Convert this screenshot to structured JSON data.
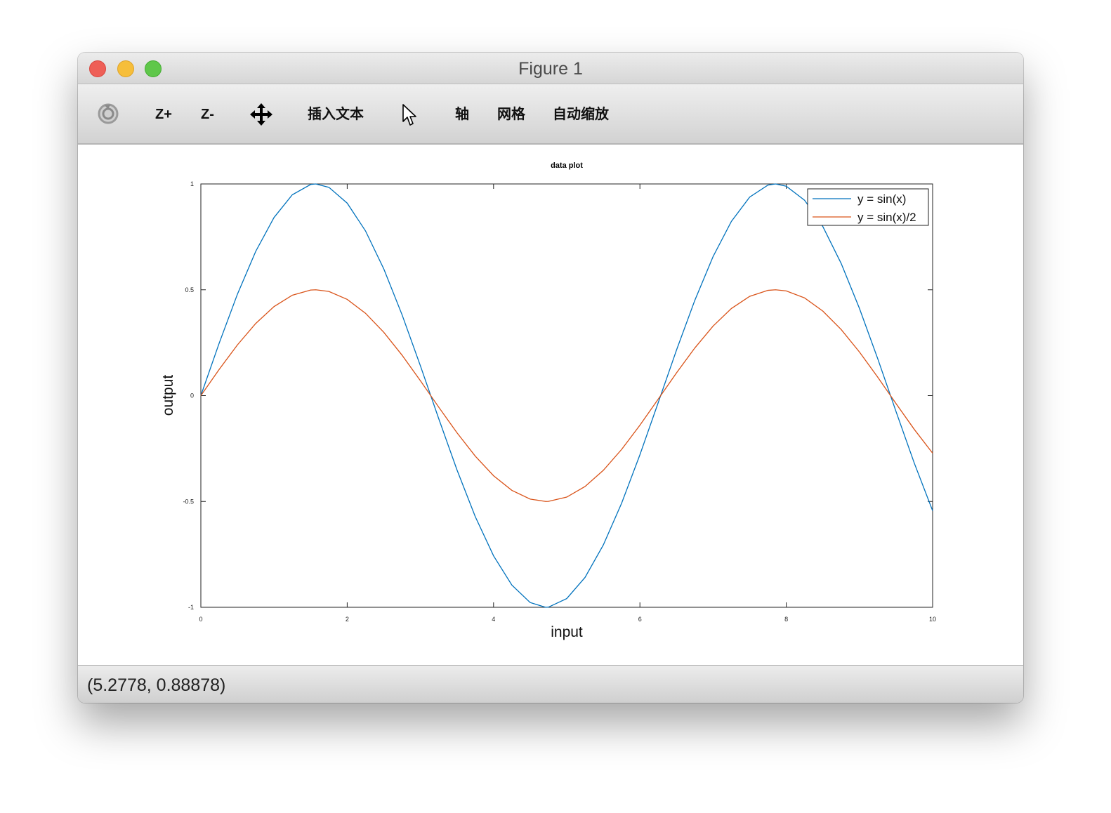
{
  "window": {
    "title": "Figure 1"
  },
  "toolbar": {
    "rotate_icon": "rotate-icon",
    "zoom_in_label": "Z+",
    "zoom_out_label": "Z-",
    "pan_icon": "move-arrows-icon",
    "insert_text_label": "插入文本",
    "select_icon": "cursor-arrow-icon",
    "axis_label": "轴",
    "grid_label": "网格",
    "autoscale_label": "自动缩放"
  },
  "status": {
    "coordinates": "(5.2778, 0.88878)"
  },
  "colors": {
    "series1": "#0072bd",
    "series2": "#d95319"
  },
  "chart_data": {
    "type": "line",
    "title": "data plot",
    "xlabel": "input",
    "ylabel": "output",
    "xlim": [
      0,
      10
    ],
    "ylim": [
      -1,
      1
    ],
    "xticks": [
      "0",
      "2",
      "4",
      "6",
      "8",
      "10"
    ],
    "yticks": [
      "-1",
      "-0.5",
      "0",
      "0.5",
      "1"
    ],
    "grid": false,
    "legend_position": "top-right",
    "series": [
      {
        "name": "y = sin(x)",
        "x": [
          0,
          0.25,
          0.5,
          0.75,
          1,
          1.25,
          1.5,
          1.5708,
          1.75,
          2,
          2.25,
          2.5,
          2.75,
          3,
          3.25,
          3.5,
          3.75,
          4,
          4.25,
          4.5,
          4.7124,
          4.75,
          5,
          5.25,
          5.5,
          5.75,
          6,
          6.25,
          6.5,
          6.75,
          7,
          7.25,
          7.5,
          7.75,
          7.854,
          8,
          8.25,
          8.5,
          8.75,
          9,
          9.25,
          9.5,
          9.75,
          10
        ],
        "y": [
          0,
          0.2474,
          0.4794,
          0.6816,
          0.8415,
          0.949,
          0.9975,
          1,
          0.984,
          0.9093,
          0.7781,
          0.5985,
          0.3817,
          0.1411,
          -0.1082,
          -0.3508,
          -0.5716,
          -0.7568,
          -0.895,
          -0.9775,
          -1,
          -0.9993,
          -0.9589,
          -0.8589,
          -0.7055,
          -0.5083,
          -0.2794,
          -0.0332,
          0.2151,
          0.45,
          0.657,
          0.8231,
          0.938,
          0.9946,
          1,
          0.9894,
          0.9231,
          0.7985,
          0.6247,
          0.4121,
          0.1743,
          -0.0752,
          -0.3195,
          -0.544
        ]
      },
      {
        "name": "y = sin(x)/2",
        "x": [
          0,
          0.25,
          0.5,
          0.75,
          1,
          1.25,
          1.5,
          1.5708,
          1.75,
          2,
          2.25,
          2.5,
          2.75,
          3,
          3.25,
          3.5,
          3.75,
          4,
          4.25,
          4.5,
          4.7124,
          4.75,
          5,
          5.25,
          5.5,
          5.75,
          6,
          6.25,
          6.5,
          6.75,
          7,
          7.25,
          7.5,
          7.75,
          7.854,
          8,
          8.25,
          8.5,
          8.75,
          9,
          9.25,
          9.5,
          9.75,
          10
        ],
        "y": [
          0,
          0.1237,
          0.2397,
          0.3408,
          0.4207,
          0.4745,
          0.4987,
          0.5,
          0.492,
          0.4546,
          0.389,
          0.2992,
          0.1909,
          0.0706,
          -0.0541,
          -0.1754,
          -0.2858,
          -0.3784,
          -0.4475,
          -0.4888,
          -0.5,
          -0.4997,
          -0.4795,
          -0.4294,
          -0.3528,
          -0.2542,
          -0.1397,
          -0.0166,
          0.1075,
          0.225,
          0.3285,
          0.4115,
          0.469,
          0.4973,
          0.5,
          0.4947,
          0.4615,
          0.3993,
          0.3124,
          0.2061,
          0.0872,
          -0.0376,
          -0.1598,
          -0.272
        ]
      }
    ]
  }
}
